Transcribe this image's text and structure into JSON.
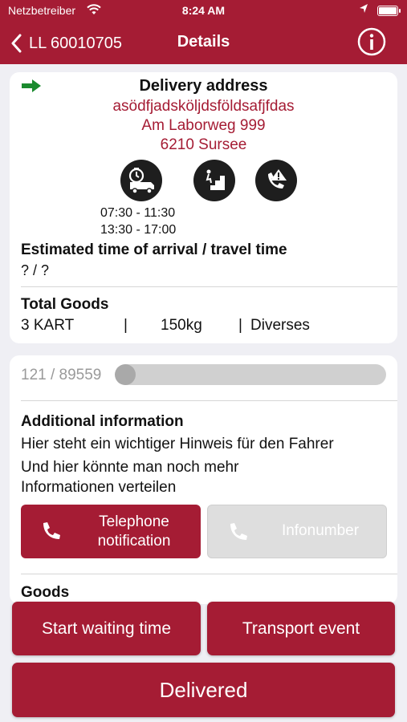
{
  "status_bar": {
    "carrier": "Netzbetreiber",
    "time": "8:24 AM"
  },
  "nav": {
    "back_label": "LL 60010705",
    "title": "Details"
  },
  "delivery": {
    "title": "Delivery address",
    "address_lines": [
      "asödfjadsköljdsföldsafjfdas",
      "Am Laborweg 999",
      "6210 Sursee"
    ],
    "icons": [
      "delivery-time-icon",
      "stairs-icon",
      "phone-alert-icon"
    ],
    "time_windows": [
      "07:30 - 11:30",
      "13:30 - 17:00"
    ],
    "eta_title": "Estimated time of arrival / travel time",
    "eta_value": "? / ?"
  },
  "total_goods": {
    "title": "Total Goods",
    "quantity": "3 KART",
    "sep1": "|",
    "weight": "150kg",
    "sep2": "|",
    "type": "Diverses"
  },
  "progress": {
    "text": "121 / 89559",
    "fraction": 0.00135
  },
  "additional_info": {
    "title": "Additional information",
    "lines": [
      "Hier steht ein wichtiger Hinweis für den Fahrer",
      "Und hier könnte man noch mehr",
      "Informationen verteilen"
    ]
  },
  "buttons": {
    "telephone_line1": "Telephone",
    "telephone_line2": "notification",
    "infonumber": "Infonumber"
  },
  "goods_section_title": "Goods",
  "actions": {
    "start_waiting": "Start waiting time",
    "transport_event": "Transport event",
    "delivered": "Delivered"
  },
  "colors": {
    "brand": "#a51c34",
    "icon_dark": "#1e1e1e",
    "arrow_green": "#1a8a2e",
    "disabled_button": "#dedede"
  }
}
